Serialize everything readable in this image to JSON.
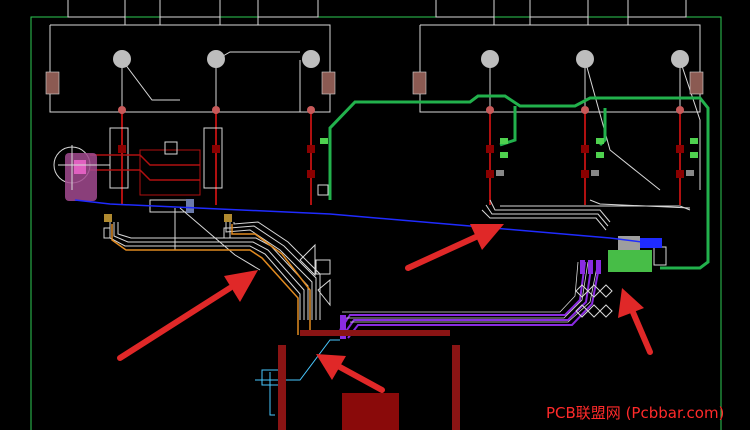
{
  "window": {
    "background": "#000000"
  },
  "board": {
    "outline_color": "#2ecc55"
  },
  "colors": {
    "wire_white": "#d8d8d8",
    "track_green": "#22b14c",
    "track_blue": "#1f2bff",
    "track_red": "#b01010",
    "track_purple": "#8a2be2",
    "track_cyan": "#48c8ff",
    "track_orange": "#e08a20",
    "pad_pink": "#e060c0",
    "pad_green": "#4fd14f",
    "annotation_arrow": "#e02828",
    "watermark": "#ff2a2a"
  },
  "watermark": {
    "text": "PCB联盟网 (Pcbbar.com)"
  },
  "arrows": [
    {
      "name": "arrow-left-bus"
    },
    {
      "name": "arrow-right-bus"
    },
    {
      "name": "arrow-right-connector"
    },
    {
      "name": "arrow-center-bottom"
    }
  ]
}
